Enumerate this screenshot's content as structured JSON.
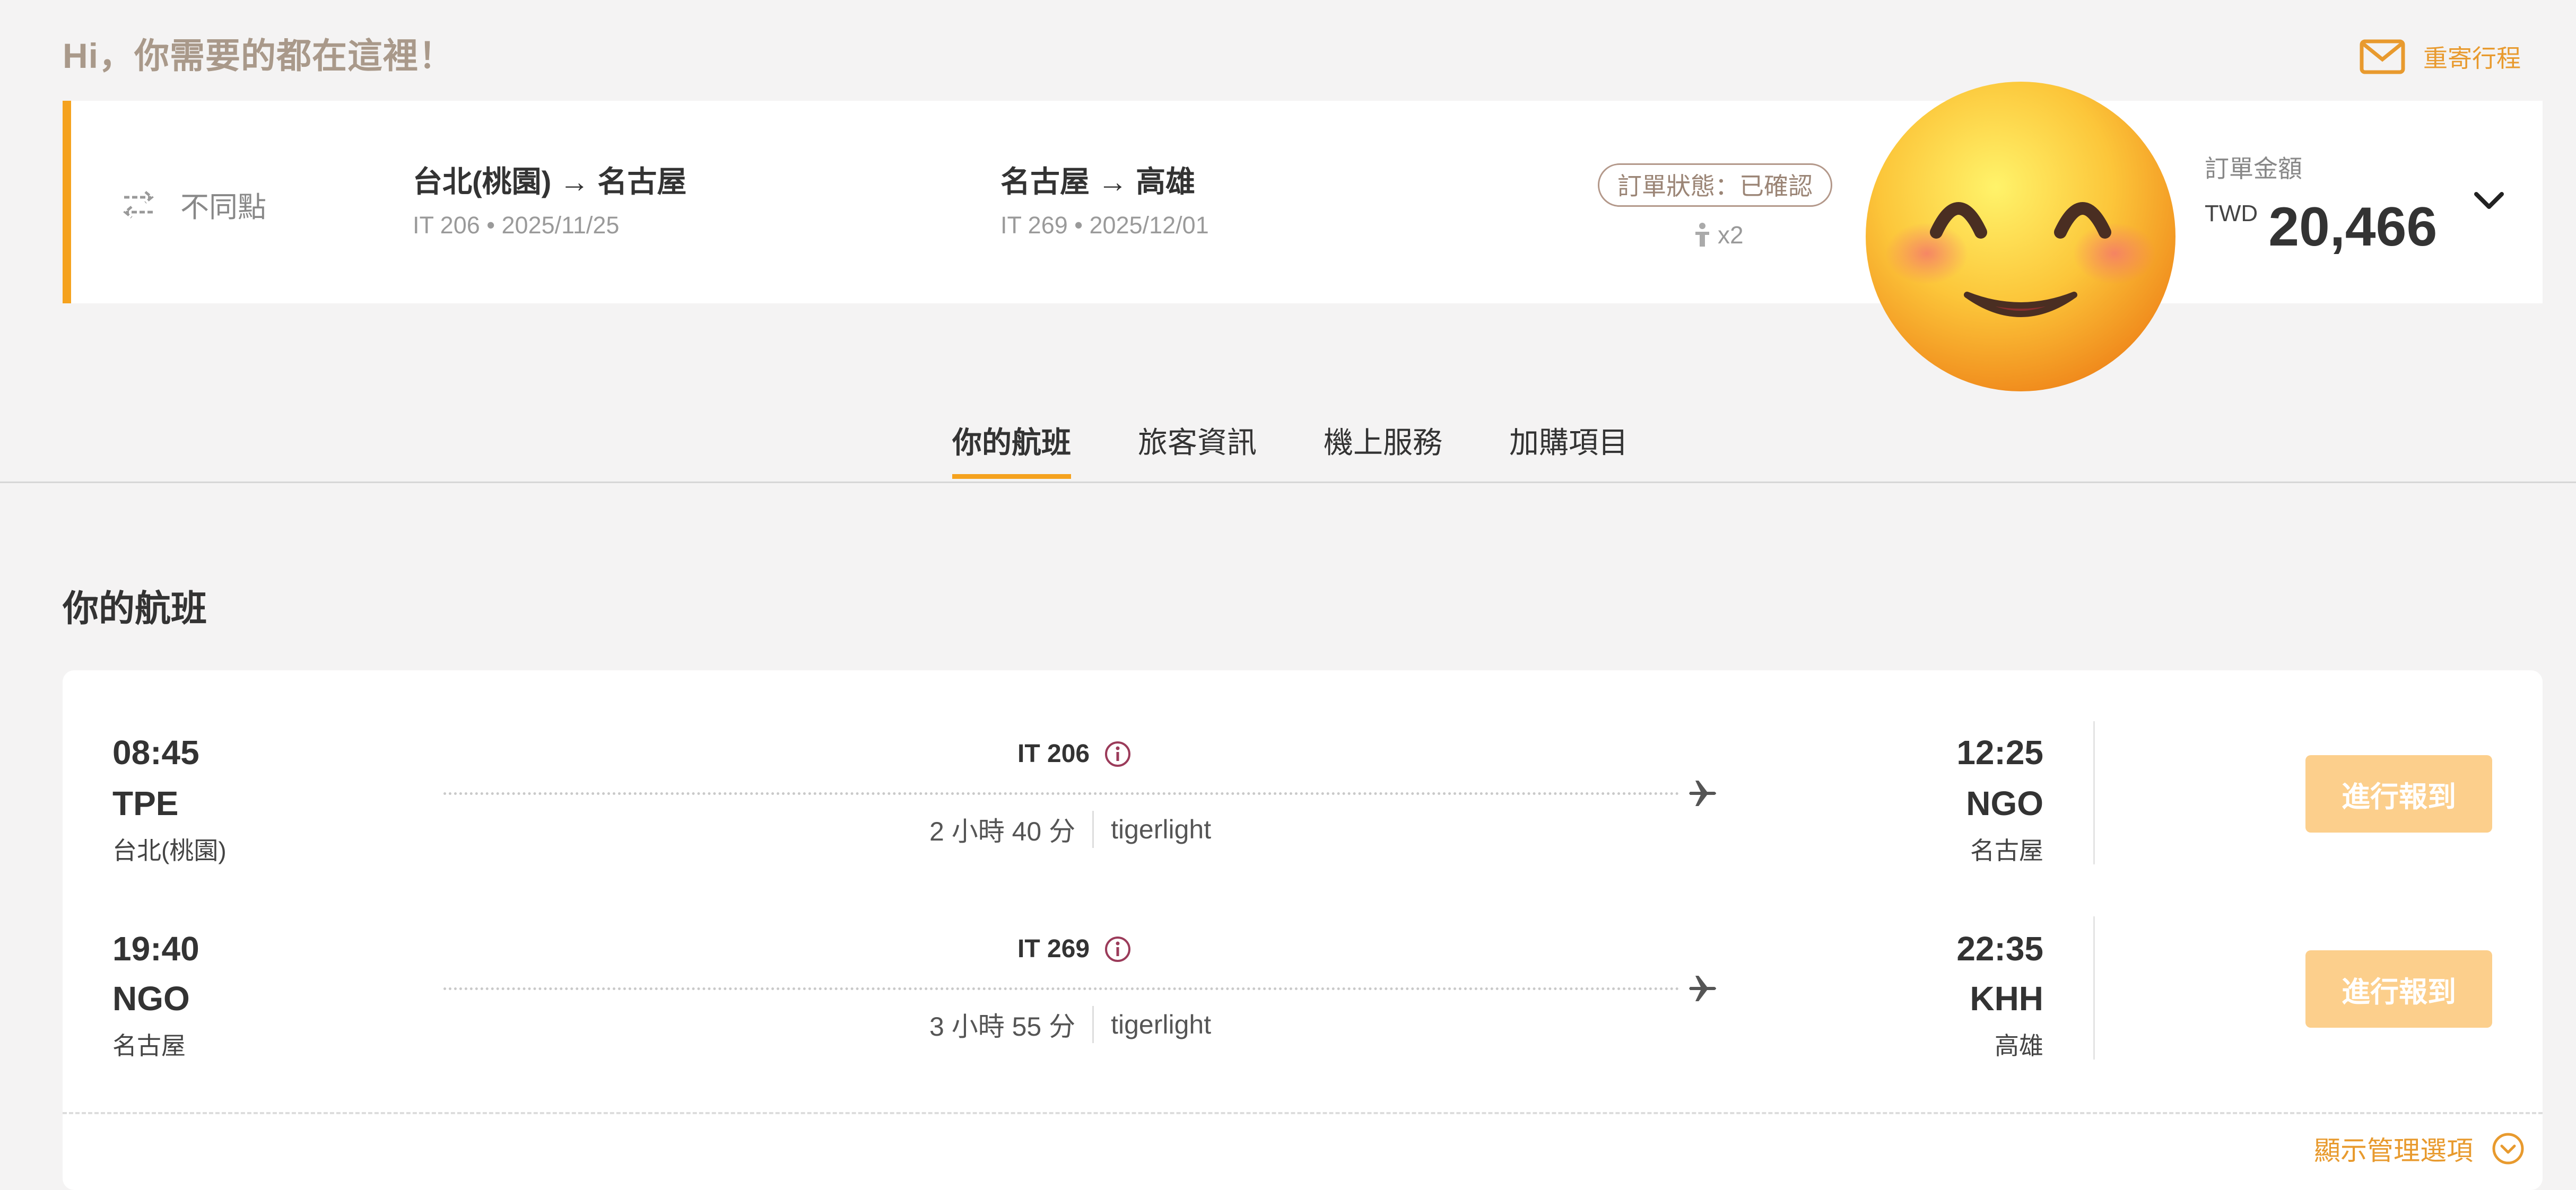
{
  "header": {
    "greeting": "Hi，你需要的都在這裡！",
    "resend_label": "重寄行程"
  },
  "summary": {
    "trip_type": "不同點",
    "segments": [
      {
        "route": "台北(桃園) → 名古屋",
        "sub": "IT 206 • 2025/11/25"
      },
      {
        "route": "名古屋 → 高雄",
        "sub": "IT 269 • 2025/12/01"
      }
    ],
    "status": "訂單狀態：已確認",
    "passengers": "x2",
    "amount_label": "訂單金額",
    "currency": "TWD",
    "amount": "20,466"
  },
  "tabs": [
    {
      "label": "你的航班",
      "active": true
    },
    {
      "label": "旅客資訊",
      "active": false
    },
    {
      "label": "機上服務",
      "active": false
    },
    {
      "label": "加購項目",
      "active": false
    }
  ],
  "section": {
    "title": "你的航班"
  },
  "flights": [
    {
      "dep_time": "08:45",
      "dep_code": "TPE",
      "dep_city": "台北(桃園)",
      "flight_no": "IT 206",
      "duration": "2 小時 40 分",
      "fare": "tigerlight",
      "arr_time": "12:25",
      "arr_code": "NGO",
      "arr_city": "名古屋",
      "checkin_label": "進行報到"
    },
    {
      "dep_time": "19:40",
      "dep_code": "NGO",
      "dep_city": "名古屋",
      "flight_no": "IT 269",
      "duration": "3 小時 55 分",
      "fare": "tigerlight",
      "arr_time": "22:35",
      "arr_code": "KHH",
      "arr_city": "高雄",
      "checkin_label": "進行報到"
    }
  ],
  "footer": {
    "manage_label": "顯示管理選項"
  },
  "colors": {
    "accent": "#f5a21e",
    "link": "#e89a2e",
    "checkin_button": "#fccf8c",
    "info_icon": "#9b3b5a"
  },
  "icons": {
    "resend": "mail-icon",
    "trip_type": "swap-arrows-icon",
    "passenger": "passenger-icon",
    "expand": "chevron-down-icon",
    "flight_info": "info-icon",
    "plane": "plane-icon",
    "manage": "chevron-circle-down-icon",
    "emoji": "smiling-face-emoji"
  }
}
